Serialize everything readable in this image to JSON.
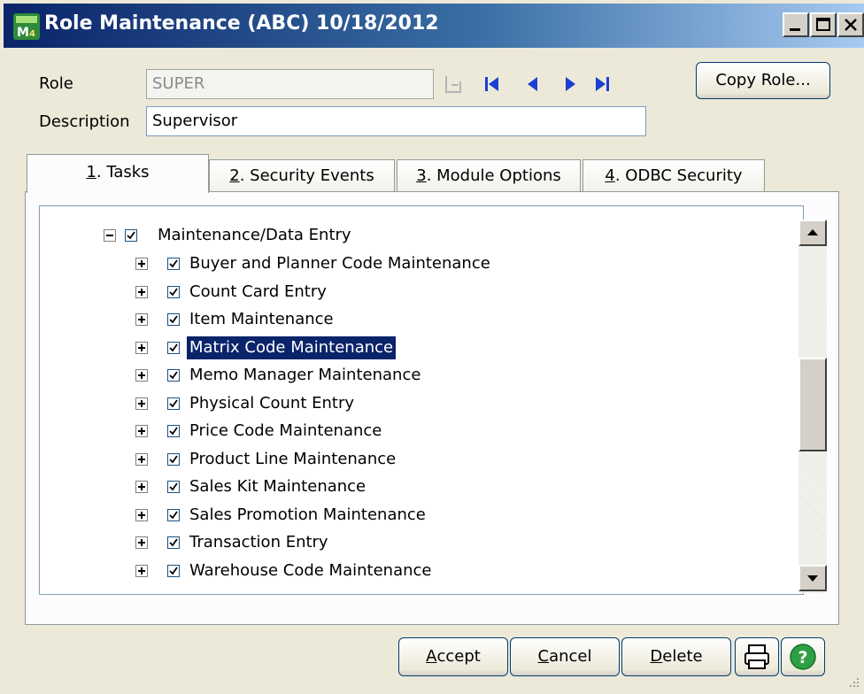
{
  "window": {
    "title": "Role Maintenance (ABC) 10/18/2012",
    "app_icon": "mas-app-icon"
  },
  "form": {
    "role_label": "Role",
    "role_value": "SUPER",
    "description_label": "Description",
    "description_value": "Supervisor",
    "copy_role_label": "Copy Role..."
  },
  "tabs": [
    {
      "key": "1",
      "rest": ". Tasks"
    },
    {
      "key": "2",
      "rest": ". Security Events"
    },
    {
      "key": "3",
      "rest": ". Module Options"
    },
    {
      "key": "4",
      "rest": ". ODBC Security"
    }
  ],
  "tree": {
    "parent": {
      "label": "Maintenance/Data Entry",
      "expanded": true,
      "checked": true
    },
    "children": [
      {
        "label": "Buyer and Planner Code Maintenance",
        "checked": true,
        "selected": false
      },
      {
        "label": "Count Card Entry",
        "checked": true,
        "selected": false
      },
      {
        "label": "Item Maintenance",
        "checked": true,
        "selected": false
      },
      {
        "label": "Matrix Code Maintenance",
        "checked": true,
        "selected": true
      },
      {
        "label": "Memo Manager Maintenance",
        "checked": true,
        "selected": false
      },
      {
        "label": "Physical Count Entry",
        "checked": true,
        "selected": false
      },
      {
        "label": "Price Code Maintenance",
        "checked": true,
        "selected": false
      },
      {
        "label": "Product Line Maintenance",
        "checked": true,
        "selected": false
      },
      {
        "label": "Sales Kit Maintenance",
        "checked": true,
        "selected": false
      },
      {
        "label": "Sales Promotion Maintenance",
        "checked": true,
        "selected": false
      },
      {
        "label": "Transaction Entry",
        "checked": true,
        "selected": false
      },
      {
        "label": "Warehouse Code Maintenance",
        "checked": true,
        "selected": false
      }
    ]
  },
  "buttons": {
    "accept_key": "A",
    "accept_rest": "ccept",
    "cancel_key": "C",
    "cancel_rest": "ancel",
    "delete_key": "D",
    "delete_rest": "elete"
  },
  "colors": {
    "selection": "#0a246a",
    "title_gradient_start": "#0a246a",
    "nav_arrow": "#1a3fd1",
    "help": "#2ea043"
  }
}
